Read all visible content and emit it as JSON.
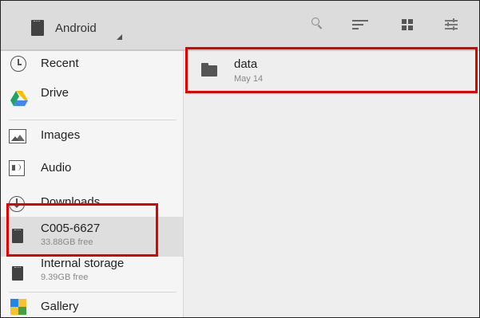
{
  "topbar": {
    "root_title": "Android",
    "icons": [
      "sd-card-icon",
      "dropdown-triangle-icon",
      "search-icon",
      "sort-icon",
      "grid-view-icon",
      "settings-icon"
    ]
  },
  "sidebar": {
    "items": [
      {
        "label": "Recent",
        "icon": "clock-icon"
      },
      {
        "label": "Drive",
        "icon": "drive-icon"
      },
      {
        "label": "Images",
        "icon": "images-icon"
      },
      {
        "label": "Audio",
        "icon": "audio-icon"
      },
      {
        "label": "Downloads",
        "icon": "downloads-icon"
      },
      {
        "label": "C005-6627",
        "sub": "33.88GB free",
        "icon": "sd-card-icon",
        "selected": true
      },
      {
        "label": "Internal storage",
        "sub": "9.39GB free",
        "icon": "sd-card-icon"
      },
      {
        "label": "Gallery",
        "icon": "gallery-icon"
      }
    ]
  },
  "files": [
    {
      "name": "data",
      "date": "May 14",
      "icon": "folder-icon"
    }
  ],
  "colors": {
    "topbar_bg": "#dcdcdc",
    "sidebar_bg": "#f5f5f5",
    "main_bg": "#eeeeee",
    "selected_bg": "#dedede",
    "highlight": "#e50000"
  }
}
